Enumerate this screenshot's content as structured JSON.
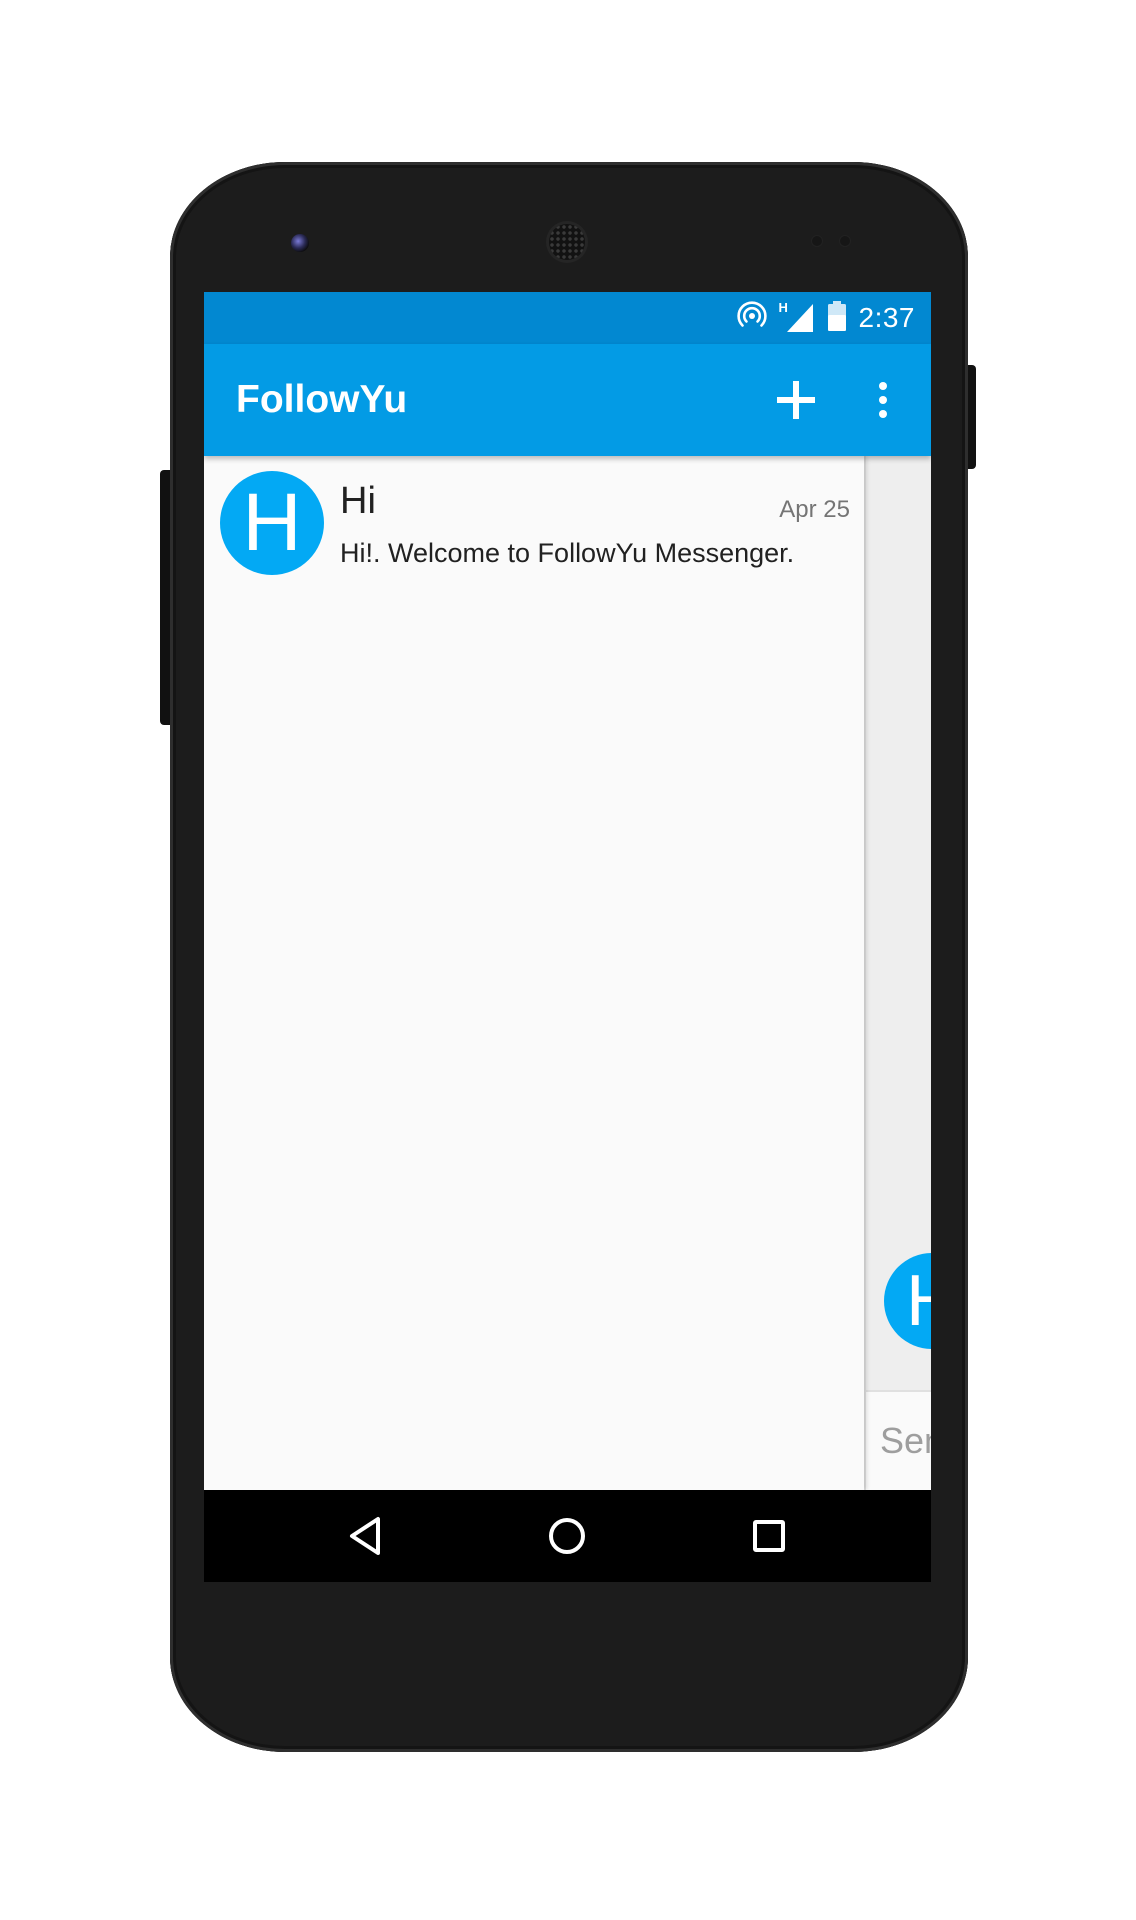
{
  "status_bar": {
    "time": "2:37",
    "network_type": "H",
    "icons": [
      "hotspot-icon",
      "signal-icon",
      "battery-icon"
    ]
  },
  "app_bar": {
    "title": "FollowYu",
    "actions": [
      "add-icon",
      "more-vert-icon"
    ]
  },
  "conversations": [
    {
      "avatar_letter": "H",
      "title": "Hi",
      "date": "Apr 25",
      "preview": "Hi!. Welcome to FollowYu Messenger."
    }
  ],
  "detail": {
    "avatar_letter": "H",
    "input_placeholder": "Send message"
  },
  "nav_bar": {
    "buttons": [
      "back-icon",
      "home-icon",
      "recents-icon"
    ]
  },
  "colors": {
    "status_bar": "#0288d1",
    "app_bar": "#039be5",
    "avatar": "#03a9f4",
    "list_background": "#fafafa",
    "nav_bar": "#000000",
    "phone_body": "#1c1c1c"
  }
}
